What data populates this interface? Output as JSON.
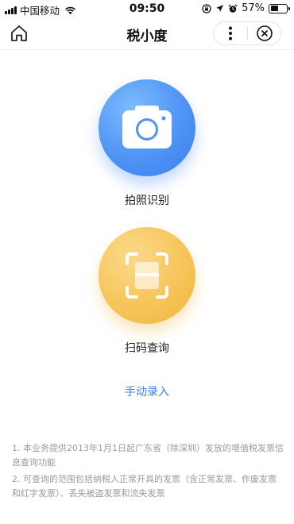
{
  "status_bar": {
    "carrier": "中国移动",
    "time": "09:50",
    "battery_text": "57%",
    "battery_level": 0.57,
    "icons": [
      "signal-icon",
      "wifi-icon",
      "screen-lock-icon",
      "location-icon",
      "alarm-icon",
      "battery-icon"
    ]
  },
  "nav": {
    "title": "税小度",
    "icons": [
      "home-icon",
      "more-icon",
      "close-icon"
    ]
  },
  "actions": [
    {
      "label": "拍照识别",
      "icon": "camera-icon",
      "color": "#4f93f4"
    },
    {
      "label": "扫码查询",
      "icon": "scan-icon",
      "color": "#f6c55a"
    }
  ],
  "manual_entry": "手动录入",
  "notes": [
    "1. 本业务提供2013年1月1日起广东省（除深圳）发放的增值税发票信息查询功能",
    "2. 可查询的范围包括纳税人正常开具的发票（含正常发票、作废发票和红字发票）、丢失被盗发票和流失发票"
  ],
  "colors": {
    "link": "#3b82e6",
    "note_text": "#9a9a9a"
  }
}
